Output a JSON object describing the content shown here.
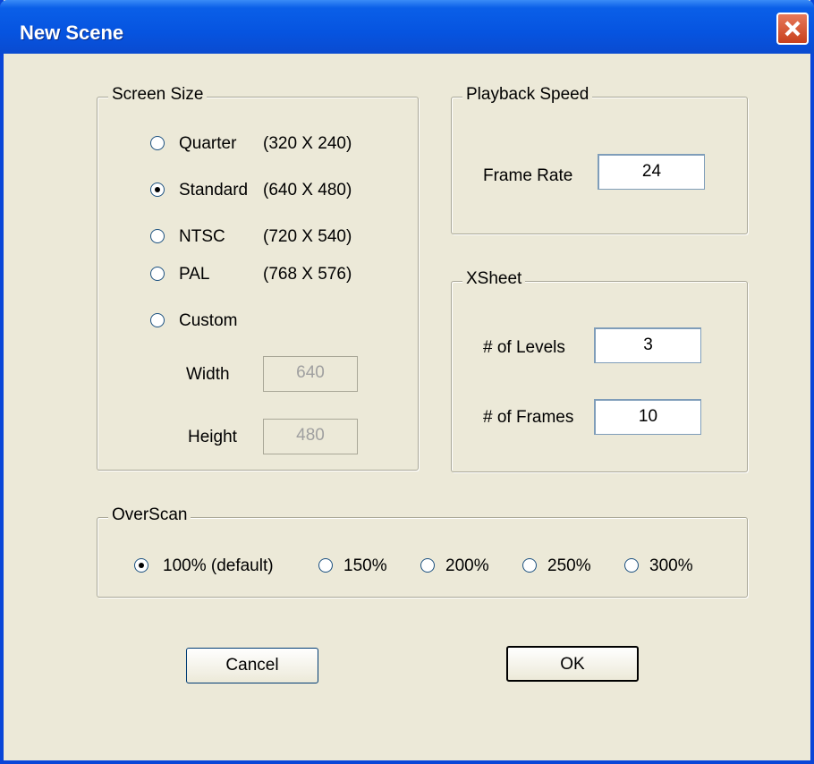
{
  "window": {
    "title": "New Scene",
    "close_icon": "close-icon"
  },
  "screen_size": {
    "legend": "Screen Size",
    "options": [
      {
        "label": "Quarter",
        "size": "(320 X 240)",
        "checked": false
      },
      {
        "label": "Standard",
        "size": "(640 X 480)",
        "checked": true
      },
      {
        "label": "NTSC",
        "size": "(720 X 540)",
        "checked": false
      },
      {
        "label": "PAL",
        "size": "(768 X 576)",
        "checked": false
      },
      {
        "label": "Custom",
        "size": "",
        "checked": false
      }
    ],
    "width_label": "Width",
    "width_value": "640",
    "height_label": "Height",
    "height_value": "480"
  },
  "playback": {
    "legend": "Playback Speed",
    "frame_rate_label": "Frame Rate",
    "frame_rate_value": "24"
  },
  "xsheet": {
    "legend": "XSheet",
    "levels_label": "# of Levels",
    "levels_value": "3",
    "frames_label": "# of Frames",
    "frames_value": "10"
  },
  "overscan": {
    "legend": "OverScan",
    "options": [
      {
        "label": "100%  (default)",
        "checked": true
      },
      {
        "label": "150%",
        "checked": false
      },
      {
        "label": "200%",
        "checked": false
      },
      {
        "label": "250%",
        "checked": false
      },
      {
        "label": "300%",
        "checked": false
      }
    ]
  },
  "buttons": {
    "cancel": "Cancel",
    "ok": "OK"
  }
}
